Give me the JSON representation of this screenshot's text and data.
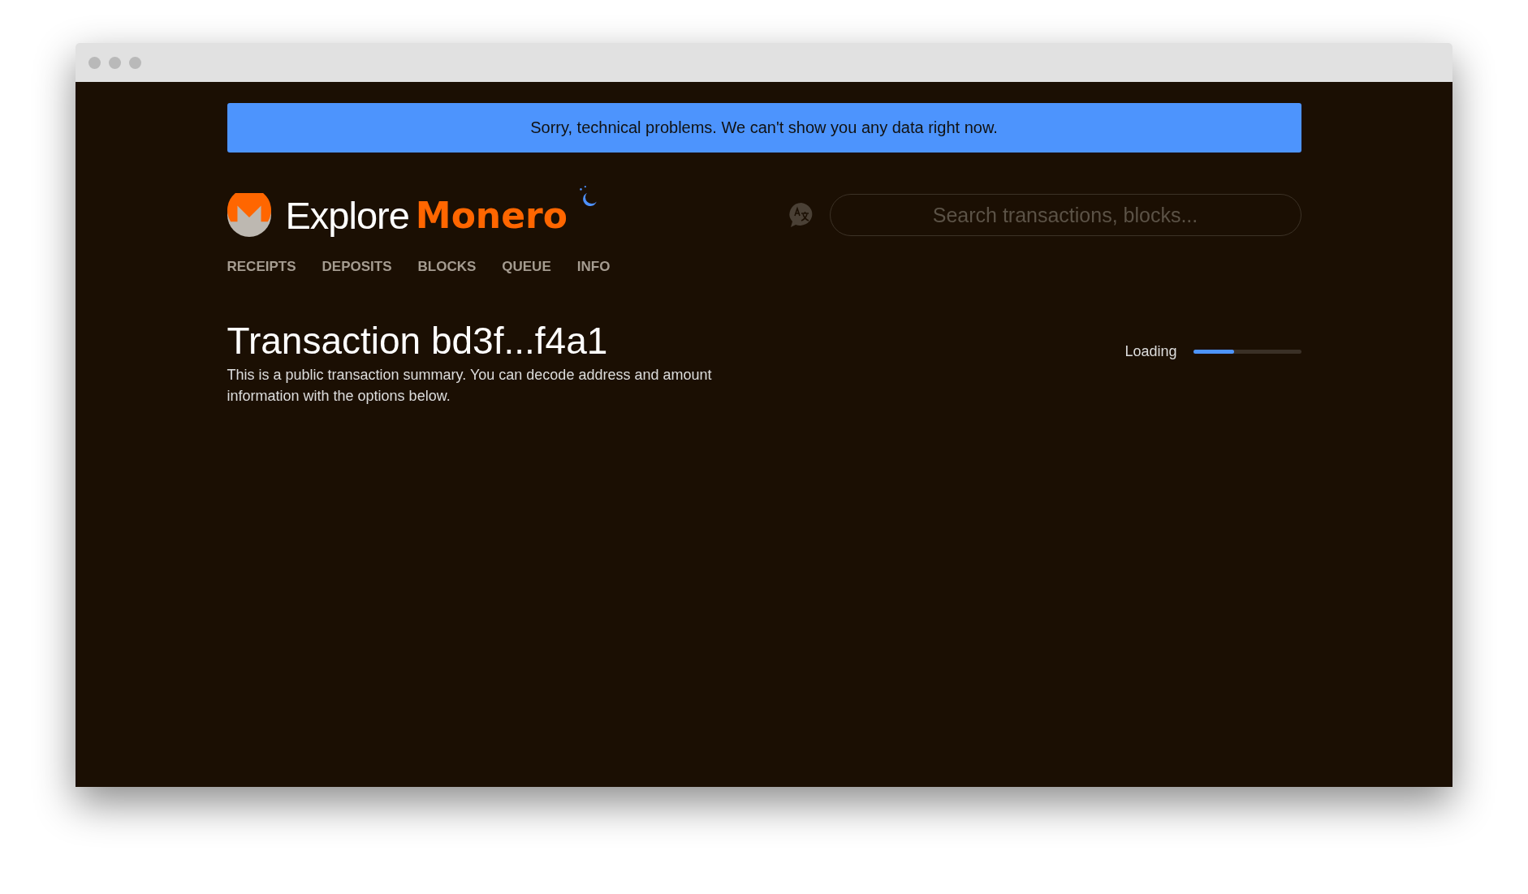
{
  "banner": {
    "text": "Sorry, technical problems. We can't show you any data right now."
  },
  "logo": {
    "word_1": "Explore",
    "word_2": "Monero"
  },
  "search": {
    "placeholder": "Search transactions, blocks..."
  },
  "nav": [
    {
      "label": "RECEIPTS"
    },
    {
      "label": "DEPOSITS"
    },
    {
      "label": "BLOCKS"
    },
    {
      "label": "QUEUE"
    },
    {
      "label": "INFO"
    }
  ],
  "transaction": {
    "title": "Transaction bd3f...f4a1",
    "description": "This is a public transaction summary. You can decode address and amount information with the options below."
  },
  "loading": {
    "label": "Loading",
    "level": 0.38
  }
}
